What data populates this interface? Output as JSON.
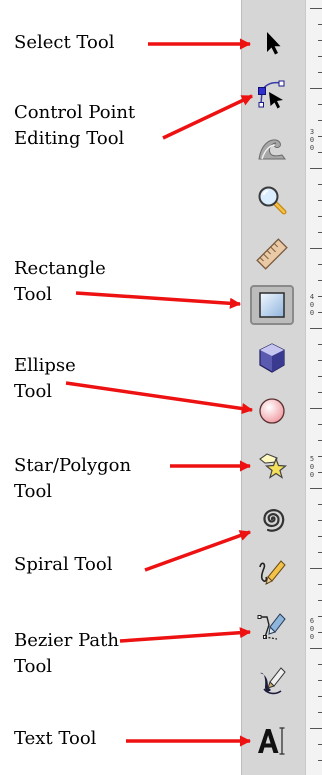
{
  "labels": {
    "select": "Select Tool",
    "node": "Control Point\nEditing Tool",
    "rect": "Rectangle\nTool",
    "ellipse": "Ellipse\nTool",
    "star": "Star/Polygon\nTool",
    "spiral": "Spiral Tool",
    "bezier": "Bezier Path\nTool",
    "text": "Text Tool"
  },
  "ruler_numbers": [
    "3\n0\n0",
    "4\n0\n0",
    "5\n0\n0",
    "6\n0\n0"
  ],
  "colors": {
    "arrow": "#ee1111",
    "toolbar": "#d6d6d6",
    "active_tool": "#bcbcbc"
  },
  "tools": [
    {
      "icon": "arrow-pointer-icon",
      "active": false
    },
    {
      "icon": "node-editor-icon",
      "active": false
    },
    {
      "icon": "tweak-wave-icon",
      "active": false
    },
    {
      "icon": "magnifier-icon",
      "active": false
    },
    {
      "icon": "ruler-measure-icon",
      "active": false
    },
    {
      "icon": "rectangle-icon",
      "active": true
    },
    {
      "icon": "3d-box-icon",
      "active": false
    },
    {
      "icon": "ellipse-icon",
      "active": false
    },
    {
      "icon": "star-icon",
      "active": false
    },
    {
      "icon": "spiral-icon",
      "active": false
    },
    {
      "icon": "pencil-icon",
      "active": false
    },
    {
      "icon": "pen-bezier-icon",
      "active": false
    },
    {
      "icon": "calligraphy-icon",
      "active": false
    },
    {
      "icon": "text-icon",
      "active": false
    }
  ]
}
